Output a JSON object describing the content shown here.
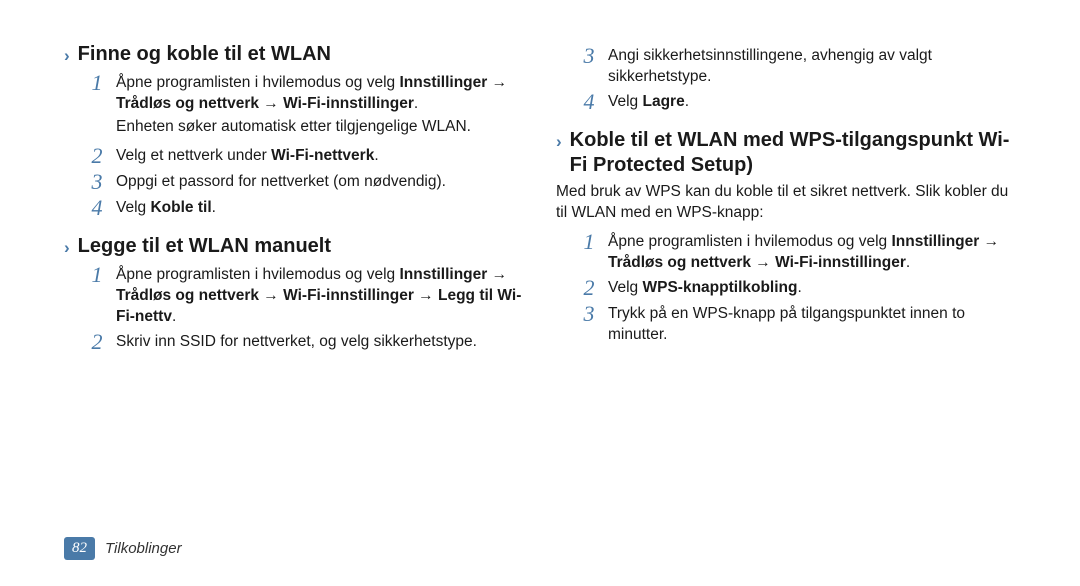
{
  "leftColumn": {
    "section1": {
      "title": "Finne og koble til et WLAN",
      "steps": [
        "Åpne programlisten i hvilemodus og velg <b>Innstillinger</b> → <b>Trådløs og nettverk</b> → <b>Wi-Fi-innstillinger</b>.",
        "__PARA__Enheten søker automatisk etter tilgjengelige WLAN.",
        "Velg et nettverk under <b>Wi-Fi-nettverk</b>.",
        "Oppgi et passord for nettverket (om nødvendig).",
        "Velg <b>Koble til</b>."
      ]
    },
    "section2": {
      "title": "Legge til et WLAN manuelt",
      "steps": [
        "Åpne programlisten i hvilemodus og velg <b>Innstillinger</b> → <b>Trådløs og nettverk</b> → <b>Wi-Fi-innstillinger</b> → <b>Legg til Wi-Fi-nettv</b>.",
        "Skriv inn SSID for nettverket, og velg sikkerhetstype."
      ]
    }
  },
  "rightColumn": {
    "continuation": {
      "steps": [
        "Angi sikkerhetsinnstillingene, avhengig av valgt sikkerhetstype.",
        "Velg <b>Lagre</b>."
      ],
      "startNum": 3
    },
    "section1": {
      "title": "Koble til et WLAN med WPS-tilgangspunkt Wi-Fi Protected Setup)",
      "intro": "Med bruk av WPS kan du koble til et sikret nettverk. Slik kobler du til WLAN med en WPS-knapp:",
      "steps": [
        "Åpne programlisten i hvilemodus og velg <b>Innstillinger</b> → <b>Trådløs og nettverk</b> → <b>Wi-Fi-innstillinger</b>.",
        "Velg <b>WPS-knapptilkobling</b>.",
        "Trykk på en WPS-knapp på tilgangspunktet innen to minutter."
      ]
    }
  },
  "footer": {
    "pageNumber": "82",
    "sectionLabel": "Tilkoblinger"
  },
  "chevron": "›"
}
